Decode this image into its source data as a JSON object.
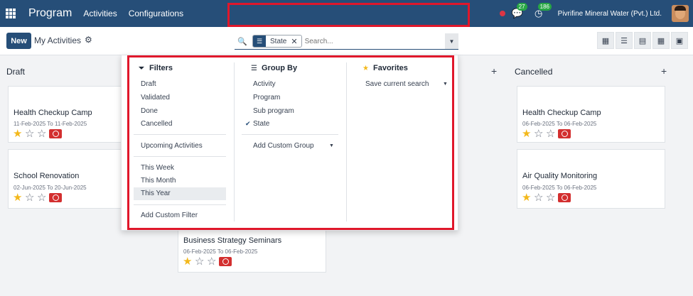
{
  "topbar": {
    "app_name": "Program",
    "nav": [
      "Activities",
      "Configurations"
    ],
    "chat_count": "27",
    "activity_count": "186",
    "company": "Pivrifine Mineral Water (Pvt.) Ltd."
  },
  "control": {
    "new_label": "New",
    "breadcrumb": "My Activities",
    "search": {
      "facet_label": "State",
      "placeholder": "Search..."
    }
  },
  "columns": [
    {
      "title": "Draft"
    },
    {
      "title": "Cancelled"
    }
  ],
  "cards": [
    {
      "title": "Health Checkup Camp",
      "dates": "11-Feb-2025 To 11-Feb-2025",
      "stars": 1
    },
    {
      "title": "School Renovation",
      "dates": "02-Jun-2025 To 20-Jun-2025",
      "stars": 1
    },
    {
      "title": "Health Checkup Camp",
      "dates": "06-Feb-2025 To 06-Feb-2025",
      "stars": 1
    },
    {
      "title": "Air Quality Monitoring",
      "dates": "06-Feb-2025 To 06-Feb-2025",
      "stars": 1
    },
    {
      "title": "Business Strategy Seminars",
      "dates": "06-Feb-2025 To 06-Feb-2025",
      "stars": 1
    }
  ],
  "dropdown": {
    "filters": {
      "title": "Filters",
      "status_items": [
        "Draft",
        "Validated",
        "Done",
        "Cancelled"
      ],
      "upcoming": "Upcoming Activities",
      "period_items": [
        "This Week",
        "This Month",
        "This Year"
      ],
      "selected_period": "This Year",
      "add_custom": "Add Custom Filter"
    },
    "group_by": {
      "title": "Group By",
      "items": [
        "Activity",
        "Program",
        "Sub program",
        "State"
      ],
      "checked": "State",
      "add_custom": "Add Custom Group"
    },
    "favorites": {
      "title": "Favorites",
      "save_current": "Save current search"
    }
  },
  "colors": {
    "navbar": "#264e78",
    "highlight": "#e0172b",
    "star": "#f3b81b",
    "activity": "#d32f2f"
  }
}
